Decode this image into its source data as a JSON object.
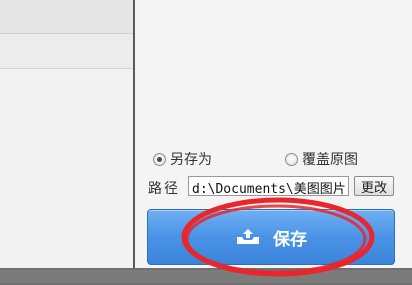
{
  "save_options": {
    "save_as_label": "另存为",
    "overwrite_label": "覆盖原图",
    "selected": "save_as"
  },
  "path": {
    "label": "路径",
    "value": "d:\\Documents\\美图图片",
    "change_button_label": "更改"
  },
  "save_button": {
    "label": "保存",
    "icon": "tray-upload-icon"
  },
  "annotation": {
    "color": "#e8262b"
  }
}
